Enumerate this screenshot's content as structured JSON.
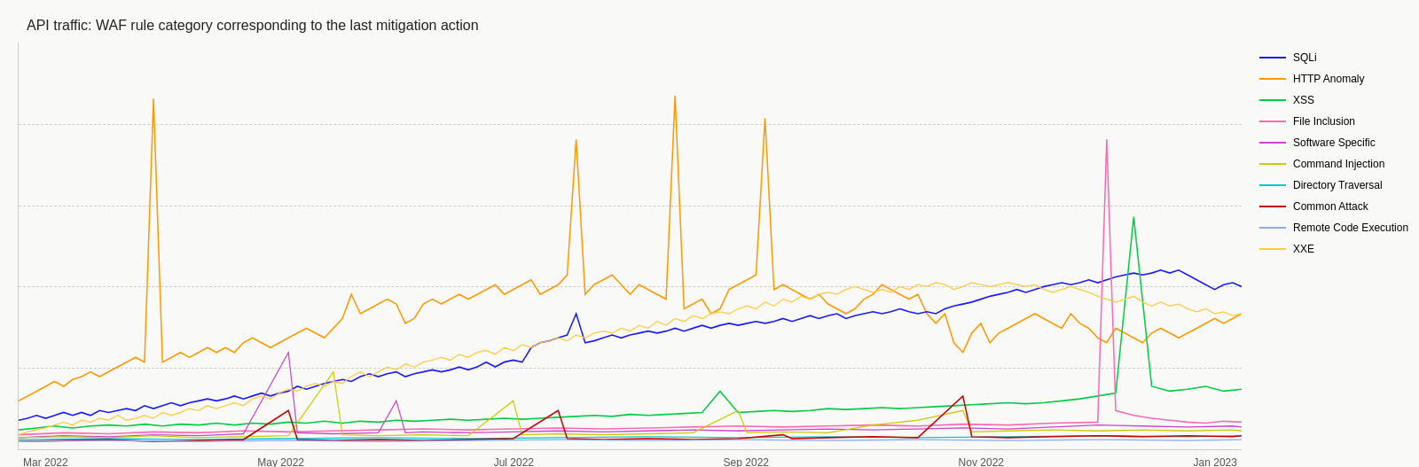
{
  "title": "API traffic: WAF rule category corresponding to the last mitigation action",
  "xLabels": [
    "Mar 2022",
    "May 2022",
    "Jul 2022",
    "Sep 2022",
    "Nov 2022",
    "Jan 2023"
  ],
  "legend": [
    {
      "label": "SQLi",
      "color": "#1a1aff"
    },
    {
      "label": "HTTP Anomaly",
      "color": "#ff9900"
    },
    {
      "label": "XSS",
      "color": "#00cc44"
    },
    {
      "label": "File Inclusion",
      "color": "#ff69b4"
    },
    {
      "label": "Software Specific",
      "color": "#cc44cc"
    },
    {
      "label": "Command Injection",
      "color": "#cccc00"
    },
    {
      "label": "Directory Traversal",
      "color": "#00cccc"
    },
    {
      "label": "Common Attack",
      "color": "#cc0000"
    },
    {
      "label": "Remote Code Execution",
      "color": "#88aaff"
    },
    {
      "label": "XXE",
      "color": "#ffcc44"
    }
  ],
  "gridLines": [
    0.2,
    0.4,
    0.6,
    0.8
  ]
}
